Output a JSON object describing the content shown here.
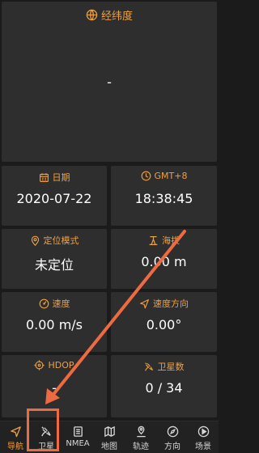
{
  "latlon": {
    "title": "经纬度",
    "value": "-"
  },
  "cards": [
    {
      "key": "date",
      "icon": "calendar-icon",
      "label": "日期",
      "value": "2020-07-22"
    },
    {
      "key": "time",
      "icon": "clock-icon",
      "label": "GMT+8",
      "value": "18:38:45"
    },
    {
      "key": "fix",
      "icon": "location-pin-icon",
      "label": "定位模式",
      "value": "未定位"
    },
    {
      "key": "alt",
      "icon": "altitude-icon",
      "label": "海拔",
      "value": "0.00 m"
    },
    {
      "key": "speed",
      "icon": "speedometer-icon",
      "label": "速度",
      "value": "0.00 m/s"
    },
    {
      "key": "heading",
      "icon": "navigation-arrow-icon",
      "label": "速度方向",
      "value": "0.00°"
    },
    {
      "key": "hdop",
      "icon": "crosshair-icon",
      "label": "HDOP",
      "value": "-"
    },
    {
      "key": "sats",
      "icon": "satellite-icon",
      "label": "卫星数",
      "value": "0 / 34"
    }
  ],
  "nav": [
    {
      "label": "导航",
      "icon": "navigation-icon",
      "active": true
    },
    {
      "label": "卫星",
      "icon": "satellite-icon",
      "active": false
    },
    {
      "label": "NMEA",
      "icon": "document-icon",
      "active": false
    },
    {
      "label": "地图",
      "icon": "map-icon",
      "active": false
    },
    {
      "label": "轨迹",
      "icon": "track-icon",
      "active": false
    },
    {
      "label": "方向",
      "icon": "compass-icon",
      "active": false
    },
    {
      "label": "场景",
      "icon": "play-icon",
      "active": false
    }
  ],
  "colors": {
    "accent": "#f0a040",
    "card": "#2e2e2e",
    "background": "#1b1b1b",
    "annotation": "#ee6a40"
  }
}
